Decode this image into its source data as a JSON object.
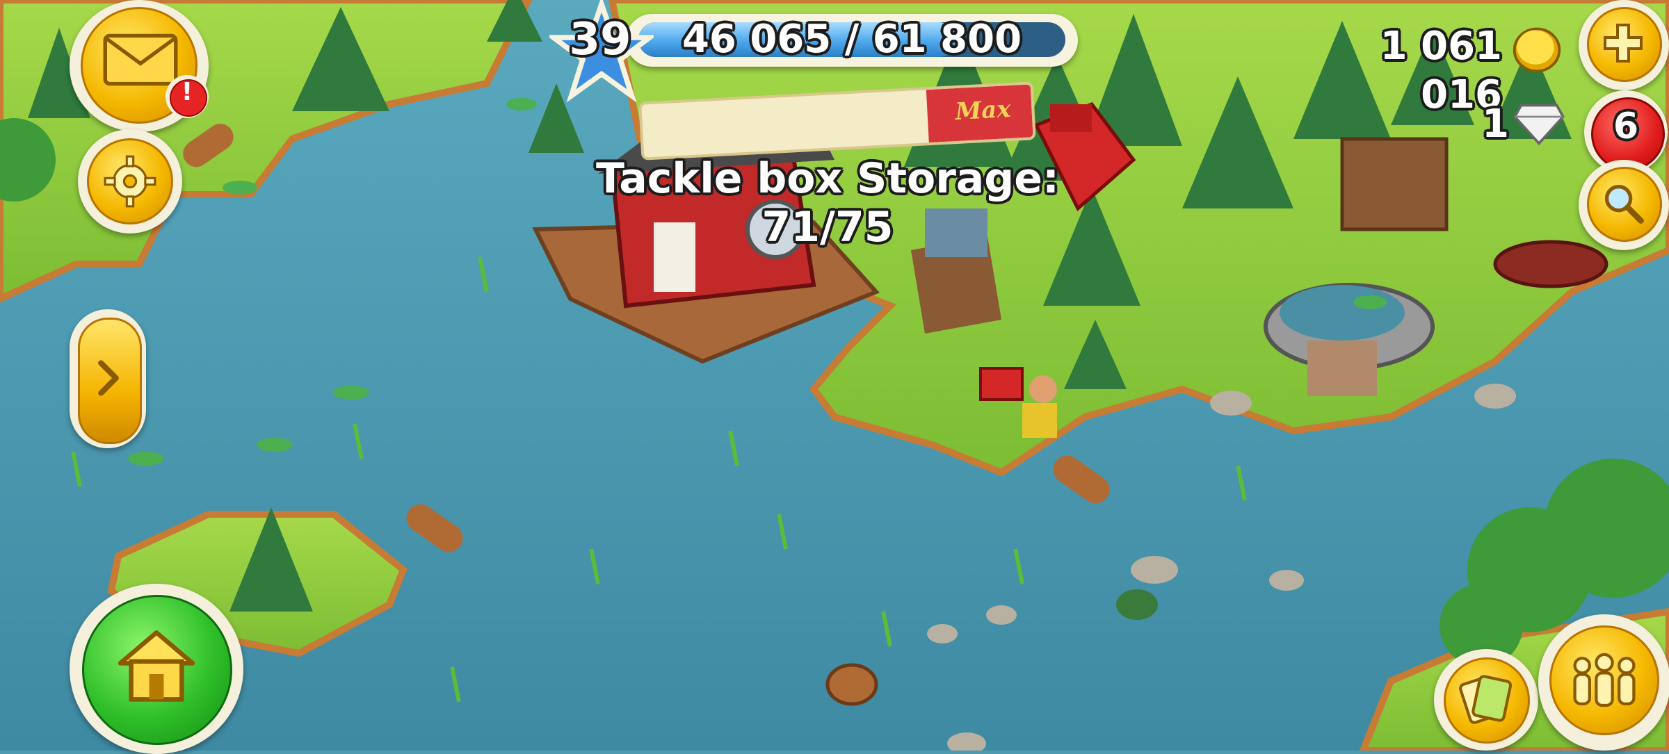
{
  "hud": {
    "level": "39",
    "xp_text": "46 065 / 61 800",
    "xp_fraction": 0.745,
    "coins": "1 061 016",
    "diamonds": "1",
    "diamond_badge_count": "6"
  },
  "storage": {
    "title": "Tackle box Storage: 71/75",
    "fraction": 0.947,
    "max_label": "Max"
  },
  "buttons": {
    "mail_alert": "!"
  },
  "icons": {
    "mail": "envelope-icon",
    "settings": "gear-icon",
    "coin": "coin-icon",
    "diamond": "diamond-icon",
    "add": "plus-icon",
    "search": "magnifier-icon",
    "expand": "chevron-right-icon",
    "home": "house-icon",
    "cards": "cards-icon",
    "friends": "friends-icon"
  },
  "colors": {
    "water": "#4e9bb0",
    "grass": "#8cc63c",
    "button_gold": "#f5b800",
    "home_green": "#2fbf2a",
    "xp_blue": "#4ea8ec",
    "alert_red": "#e01c1c"
  }
}
